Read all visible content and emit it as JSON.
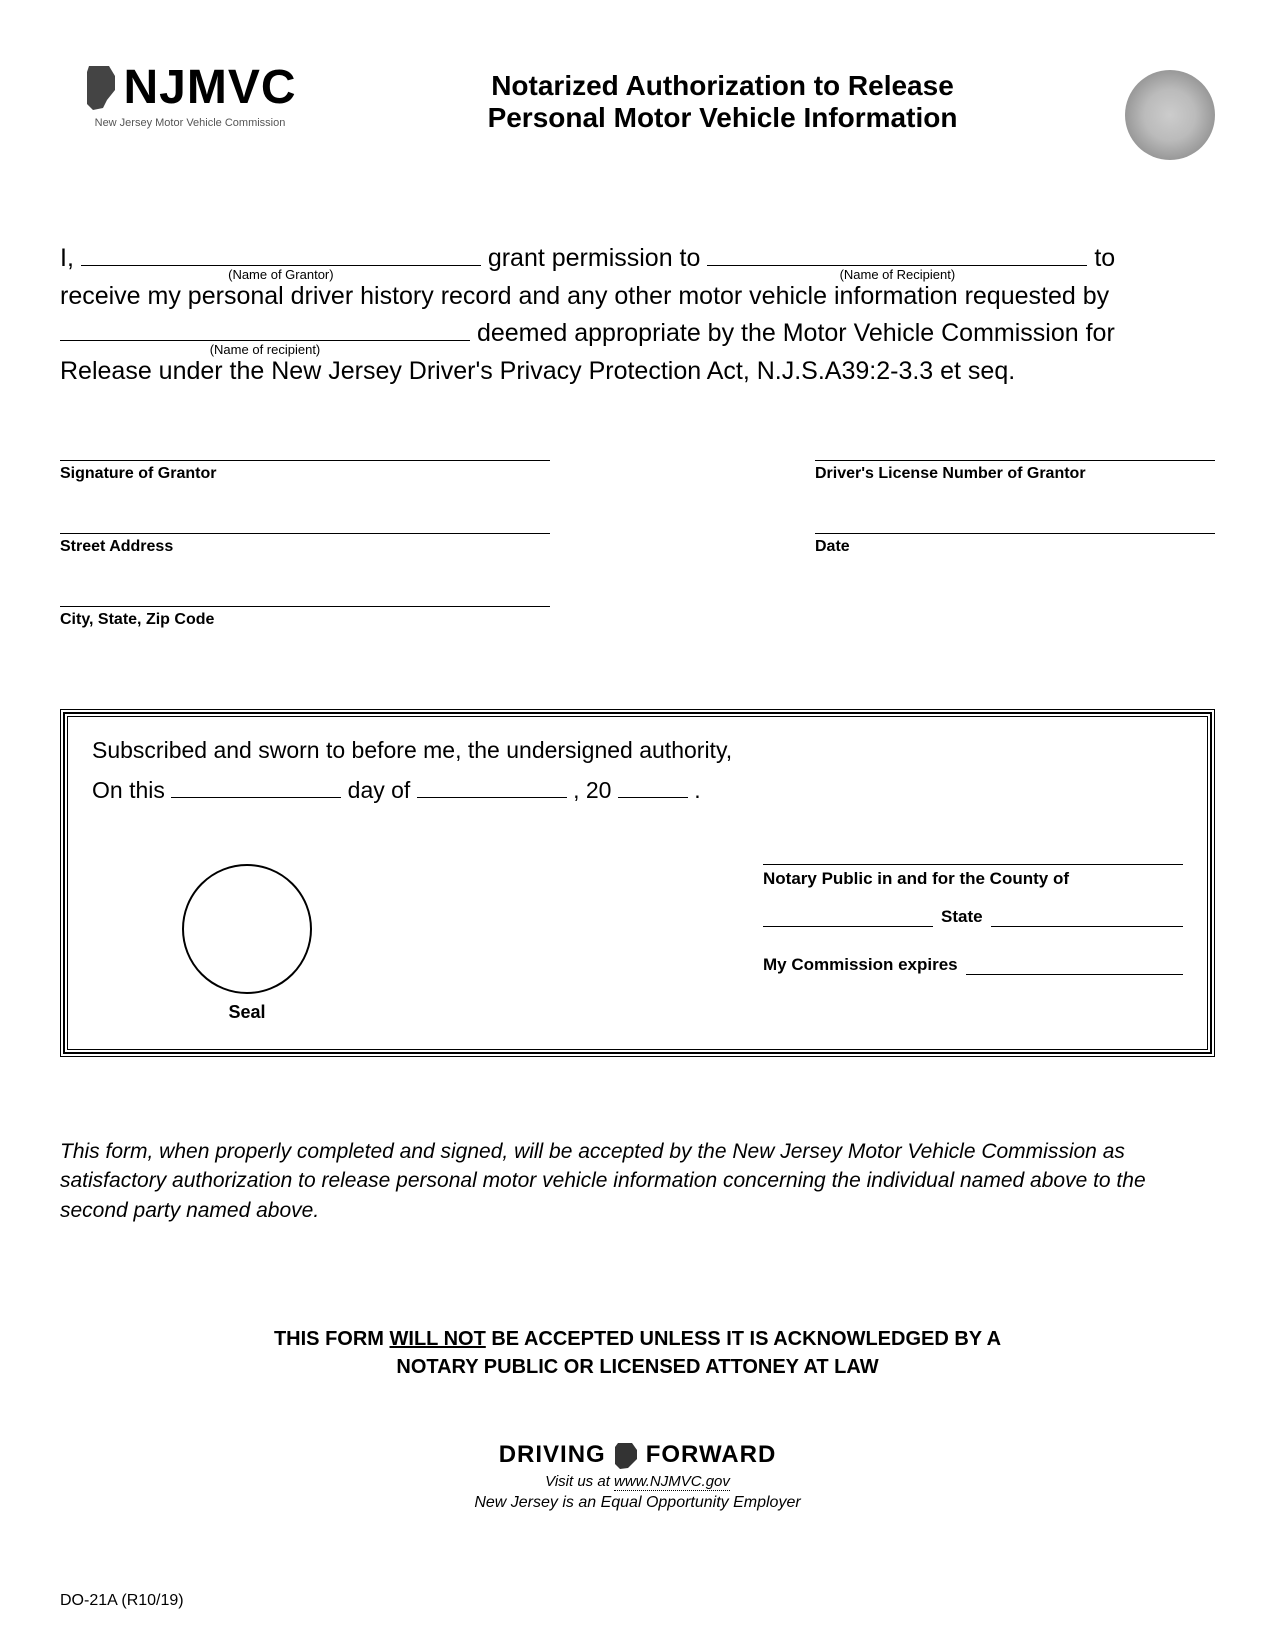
{
  "header": {
    "logo_text": "NJMVC",
    "logo_sub": "New Jersey Motor Vehicle Commission",
    "title_line1": "Notarized Authorization to Release",
    "title_line2": "Personal Motor Vehicle Information"
  },
  "body": {
    "i": "I,",
    "grantor_caption": "(Name of Grantor)",
    "grant_permission": "grant permission to",
    "recipient_caption": "(Name of Recipient)",
    "to": "to",
    "line2": "receive my  personal driver history record and any other motor vehicle information requested by",
    "recipient_caption2": "(Name of recipient)",
    "line3": "deemed appropriate by the Motor Vehicle Commission for",
    "line4": "Release under the New Jersey Driver's Privacy Protection Act, N.J.S.A39:2-3.3 et seq."
  },
  "sig": {
    "grantor_sig": "Signature of Grantor",
    "dl_number": "Driver's License Number of Grantor",
    "street": "Street Address",
    "date": "Date",
    "csz": "City, State, Zip Code"
  },
  "notary": {
    "subscribed": "Subscribed and sworn to before me, the undersigned authority,",
    "on_this": "On this",
    "day_of": "day of",
    "comma20": ", 20",
    "period": ".",
    "seal": "Seal",
    "county": "Notary Public in and for the County of",
    "state": "State",
    "commission": "My Commission expires"
  },
  "disclaimer": "This form, when properly completed and signed, will be accepted by the New Jersey Motor Vehicle Commission as satisfactory authorization to release personal motor vehicle information concerning the individual named above to the second party named above.",
  "warn": {
    "pre": "THIS FORM ",
    "willnot": "WILL NOT",
    "post": " BE ACCEPTED UNLESS IT IS ACKNOWLEDGED BY A",
    "line2": "NOTARY PUBLIC OR LICENSED ATTONEY AT LAW"
  },
  "footer": {
    "driving": "DRIVING",
    "forward": "FORWARD",
    "visit_pre": "Visit us at ",
    "url": "www.NJMVC.gov",
    "eoe": "New Jersey is an Equal Opportunity Employer"
  },
  "form_code": "DO-21A (R10/19)"
}
